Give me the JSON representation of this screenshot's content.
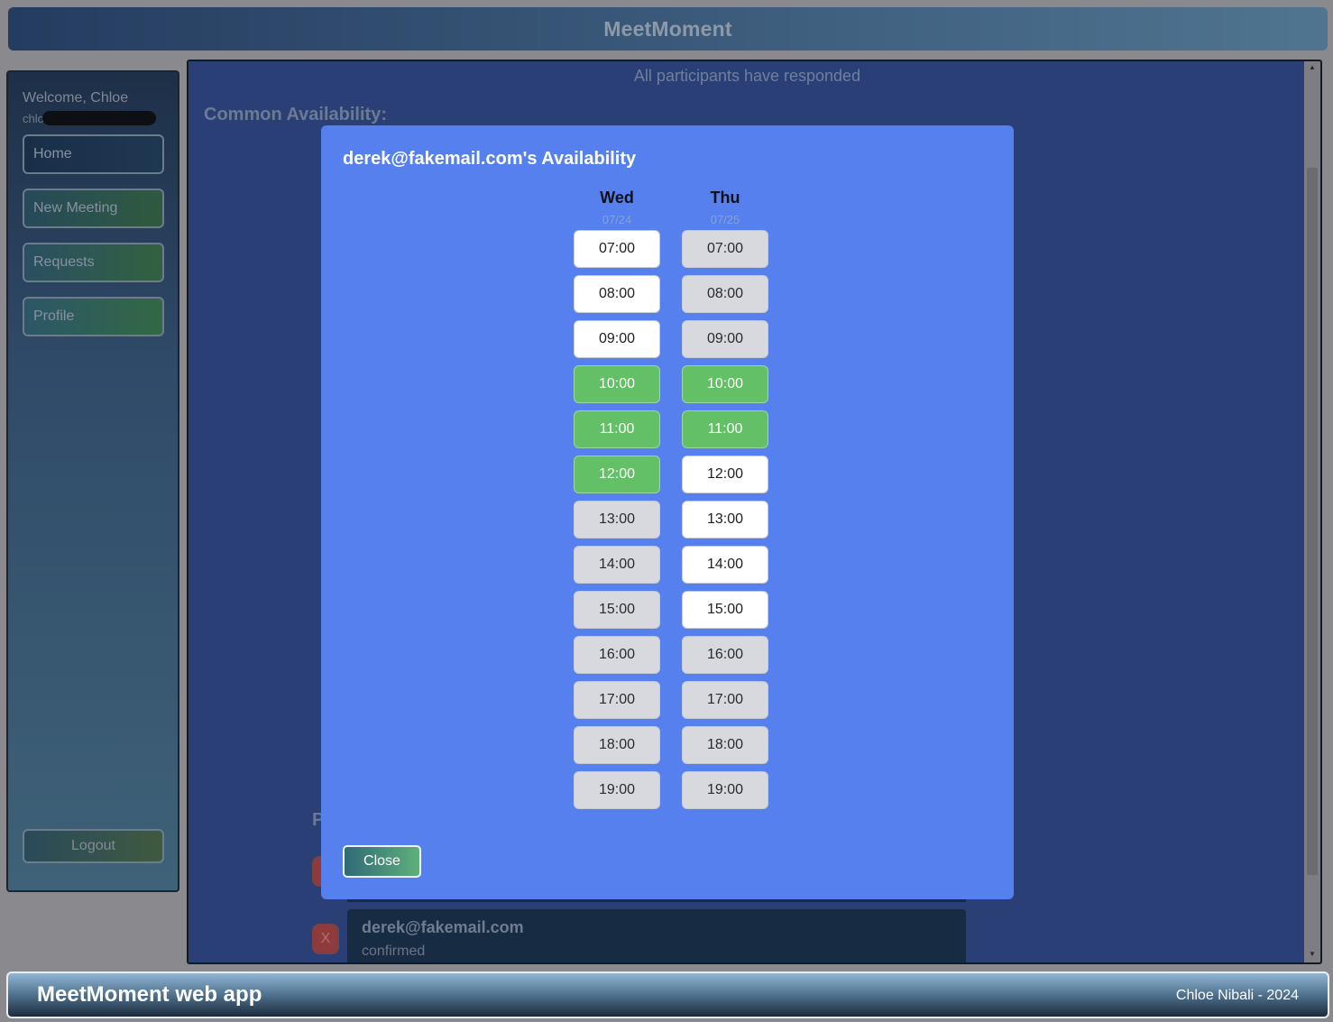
{
  "app": {
    "title": "MeetMoment"
  },
  "sidebar": {
    "welcome": "Welcome, Chloe",
    "email_visible": "chlo",
    "items": [
      {
        "label": "Home"
      },
      {
        "label": "New Meeting"
      },
      {
        "label": "Requests"
      },
      {
        "label": "Profile"
      }
    ],
    "logout_label": "Logout"
  },
  "main": {
    "status": "All participants have responded",
    "common_title": "Common Availability:",
    "participants_heading_visible": "P",
    "participant": {
      "remove_label": "X",
      "email": "derek@fakemail.com",
      "status": "confirmed"
    }
  },
  "modal": {
    "title": "derek@fakemail.com's Availability",
    "days": [
      {
        "name": "Wed",
        "date": "07/24",
        "slots": [
          {
            "time": "07:00",
            "state": "available"
          },
          {
            "time": "08:00",
            "state": "available"
          },
          {
            "time": "09:00",
            "state": "available"
          },
          {
            "time": "10:00",
            "state": "common"
          },
          {
            "time": "11:00",
            "state": "common"
          },
          {
            "time": "12:00",
            "state": "common"
          },
          {
            "time": "13:00",
            "state": "unavailable"
          },
          {
            "time": "14:00",
            "state": "unavailable"
          },
          {
            "time": "15:00",
            "state": "unavailable"
          },
          {
            "time": "16:00",
            "state": "unavailable"
          },
          {
            "time": "17:00",
            "state": "unavailable"
          },
          {
            "time": "18:00",
            "state": "unavailable"
          },
          {
            "time": "19:00",
            "state": "unavailable"
          }
        ]
      },
      {
        "name": "Thu",
        "date": "07/25",
        "slots": [
          {
            "time": "07:00",
            "state": "unavailable"
          },
          {
            "time": "08:00",
            "state": "unavailable"
          },
          {
            "time": "09:00",
            "state": "unavailable"
          },
          {
            "time": "10:00",
            "state": "common"
          },
          {
            "time": "11:00",
            "state": "common"
          },
          {
            "time": "12:00",
            "state": "available"
          },
          {
            "time": "13:00",
            "state": "available"
          },
          {
            "time": "14:00",
            "state": "available"
          },
          {
            "time": "15:00",
            "state": "available"
          },
          {
            "time": "16:00",
            "state": "unavailable"
          },
          {
            "time": "17:00",
            "state": "unavailable"
          },
          {
            "time": "18:00",
            "state": "unavailable"
          },
          {
            "time": "19:00",
            "state": "unavailable"
          }
        ]
      }
    ],
    "close_label": "Close"
  },
  "footer": {
    "left": "MeetMoment web app",
    "right": "Chloe Nibali - 2024"
  },
  "colors": {
    "available": "#ffffff",
    "unavailable": "#d7d9de",
    "common": "#63c066",
    "modal_bg": "#5580ee",
    "main_bg": "#293f76"
  }
}
